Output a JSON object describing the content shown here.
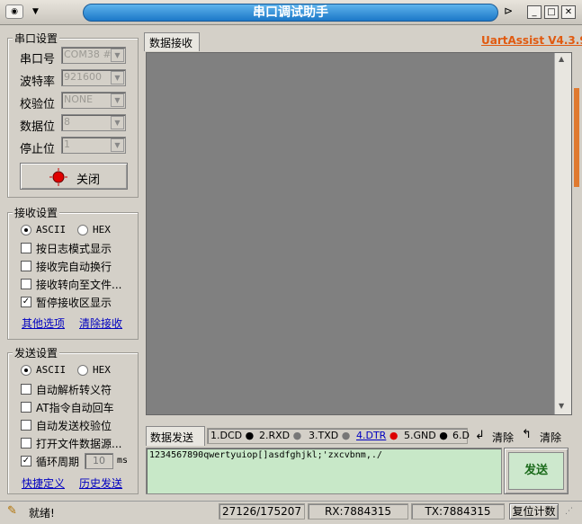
{
  "window": {
    "title": "串口调试助手"
  },
  "serial_settings": {
    "title": "串口设置",
    "port_label": "串口号",
    "port_value": "COM38 #L",
    "baud_label": "波特率",
    "baud_value": "921600",
    "parity_label": "校验位",
    "parity_value": "NONE",
    "databits_label": "数据位",
    "databits_value": "8",
    "stopbits_label": "停止位",
    "stopbits_value": "1",
    "close_button": "关闭"
  },
  "receive_settings": {
    "title": "接收设置",
    "ascii_label": "ASCII",
    "hex_label": "HEX",
    "format_selected": "ASCII",
    "log_mode": "按日志模式显示",
    "auto_newline": "接收完自动换行",
    "redirect_file": "接收转向至文件...",
    "pause_display": "暂停接收区显示",
    "other_options": "其他选项",
    "clear_receive": "清除接收"
  },
  "send_settings": {
    "title": "发送设置",
    "ascii_label": "ASCII",
    "hex_label": "HEX",
    "format_selected": "ASCII",
    "auto_escape": "自动解析转义符",
    "at_cr": "AT指令自动回车",
    "auto_checksum": "自动发送校验位",
    "open_file": "打开文件数据源...",
    "loop_period": "循环周期",
    "loop_value": "10",
    "loop_unit": "ms",
    "shortcut": "快捷定义",
    "history": "历史发送"
  },
  "receive_panel": {
    "tab_label": "数据接收",
    "brand": "UartAssist V4.3.9",
    "brand_color": "#e05a10"
  },
  "send_panel": {
    "tab_label": "数据发送",
    "signals": [
      {
        "label": "1.DCD",
        "color": "#000000"
      },
      {
        "label": "2.RXD",
        "color": "#777777"
      },
      {
        "label": "3.TXD",
        "color": "#777777"
      },
      {
        "label": "4.DTR",
        "color": "#dd0000"
      },
      {
        "label": "5.GND",
        "color": "#000000"
      },
      {
        "label": "6.D",
        "color": "#000000"
      }
    ],
    "clear_label_1": "清除",
    "clear_label_2": "清除",
    "input_value": "1234567890qwertyuiop[]asdfghjkl;'zxcvbnm,./",
    "send_button": "发送"
  },
  "status_bar": {
    "ready": "就绪!",
    "counter": "27126/175207",
    "rx": "RX:7884315",
    "tx": "TX:7884315",
    "reset_button": "复位计数"
  }
}
